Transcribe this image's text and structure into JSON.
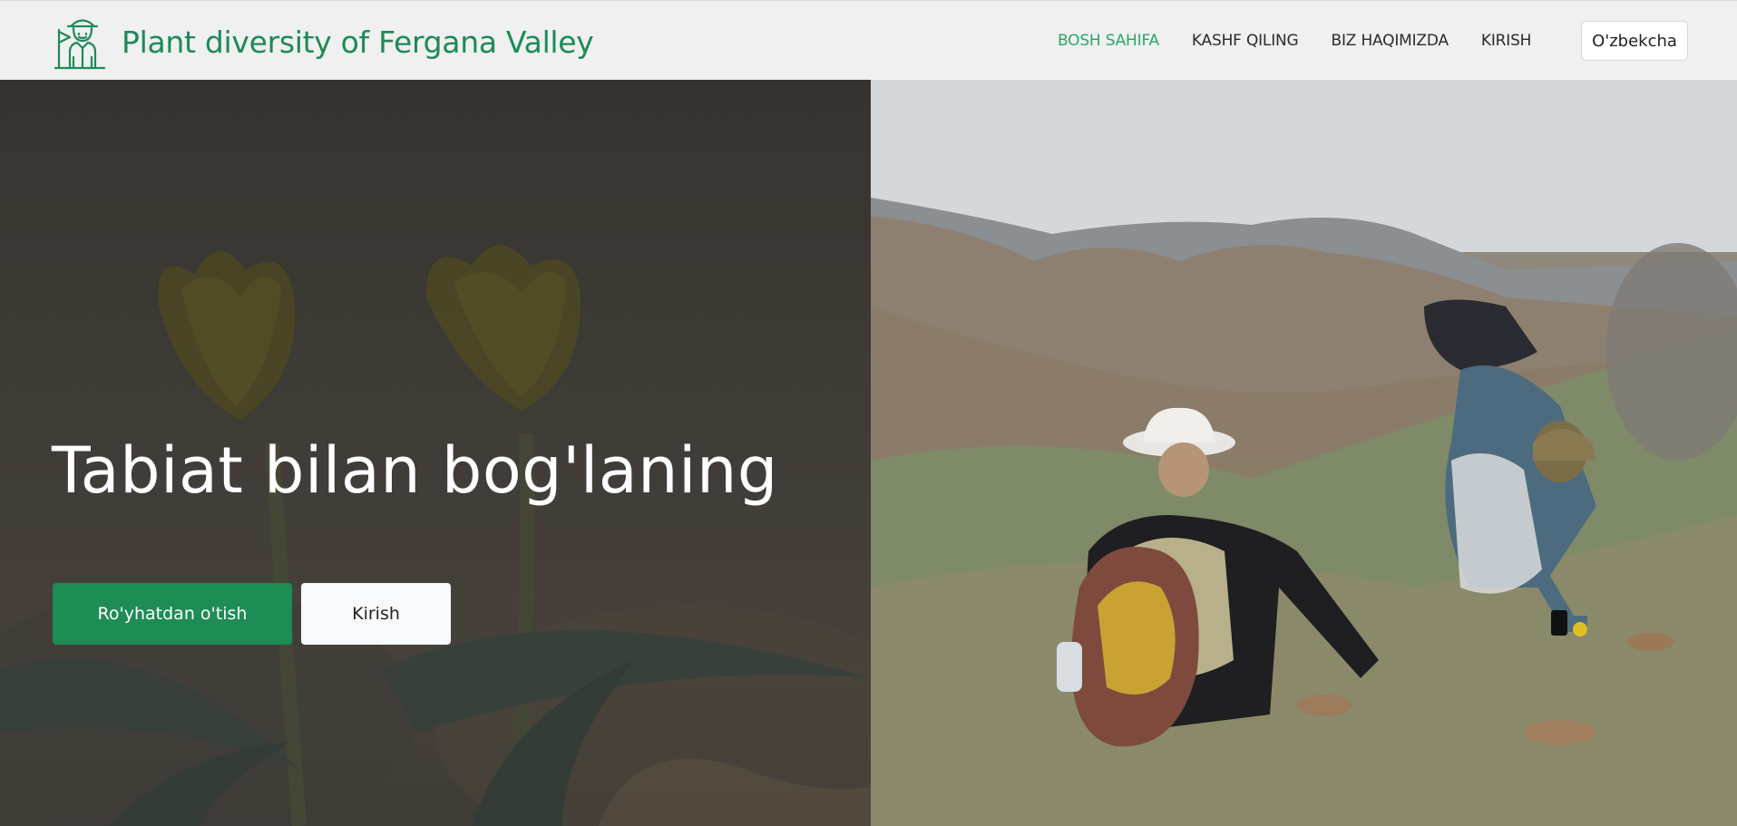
{
  "brand": {
    "title": "Plant diversity of Fergana Valley",
    "logo_icon": "botanist-explorer-icon",
    "color": "#1e8a57"
  },
  "nav": {
    "items": [
      {
        "label": "BOSH SAHIFA",
        "active": true
      },
      {
        "label": "KASHF QILING",
        "active": false
      },
      {
        "label": "BIZ HAQIMIZDA",
        "active": false
      },
      {
        "label": "KIRISH",
        "active": false
      }
    ],
    "active_color": "#27a866",
    "language": "O'zbekcha"
  },
  "hero": {
    "heading": "Tabiat bilan bog'laning",
    "register_button": "Ro'yhatdan o'tish",
    "login_button": "Kirish",
    "left_image": "yellow-tulip-photo",
    "right_image": "botanists-on-hillside-photo"
  },
  "colors": {
    "primary": "#1e8c55",
    "navbar_bg": "#f0f0f0"
  }
}
